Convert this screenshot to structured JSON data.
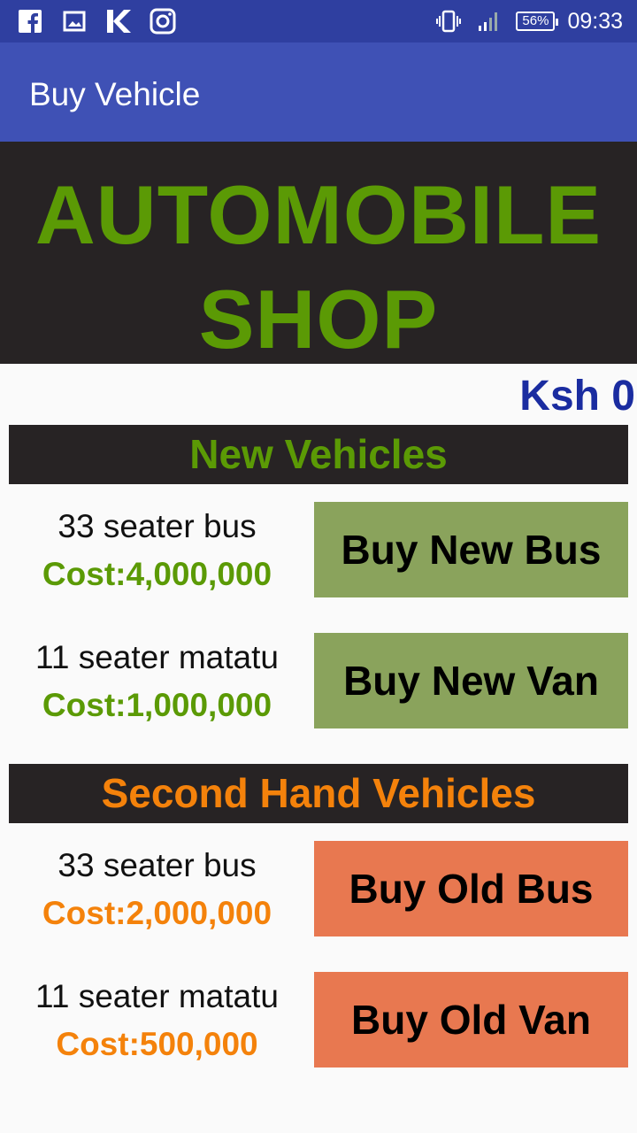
{
  "status_bar": {
    "left_icons": [
      "facebook-icon",
      "gallery-icon",
      "k-app-icon",
      "instagram-icon"
    ],
    "battery": "56%",
    "time": "09:33"
  },
  "app_bar": {
    "title": "Buy Vehicle"
  },
  "banner": {
    "line1": "AUTOMOBILE",
    "line2": "SHOP"
  },
  "balance": "Ksh 0",
  "sections": {
    "new": {
      "title": "New Vehicles",
      "items": [
        {
          "name": "33 seater bus",
          "cost": "Cost:4,000,000",
          "button": "Buy New Bus"
        },
        {
          "name": "11 seater matatu",
          "cost": "Cost:1,000,000",
          "button": "Buy New Van"
        }
      ]
    },
    "used": {
      "title": "Second Hand Vehicles",
      "items": [
        {
          "name": "33 seater bus",
          "cost": "Cost:2,000,000",
          "button": "Buy Old Bus"
        },
        {
          "name": "11 seater matatu",
          "cost": "Cost:500,000",
          "button": "Buy Old Van"
        }
      ]
    }
  },
  "colors": {
    "app_bar": "#3f51b5",
    "status_bar": "#2f3fa0",
    "banner_bg": "#272324",
    "green": "#5b9a05",
    "orange": "#f4820b",
    "balance": "#1a2ca0",
    "green_button": "#8aa35c",
    "orange_button": "#e87850"
  }
}
